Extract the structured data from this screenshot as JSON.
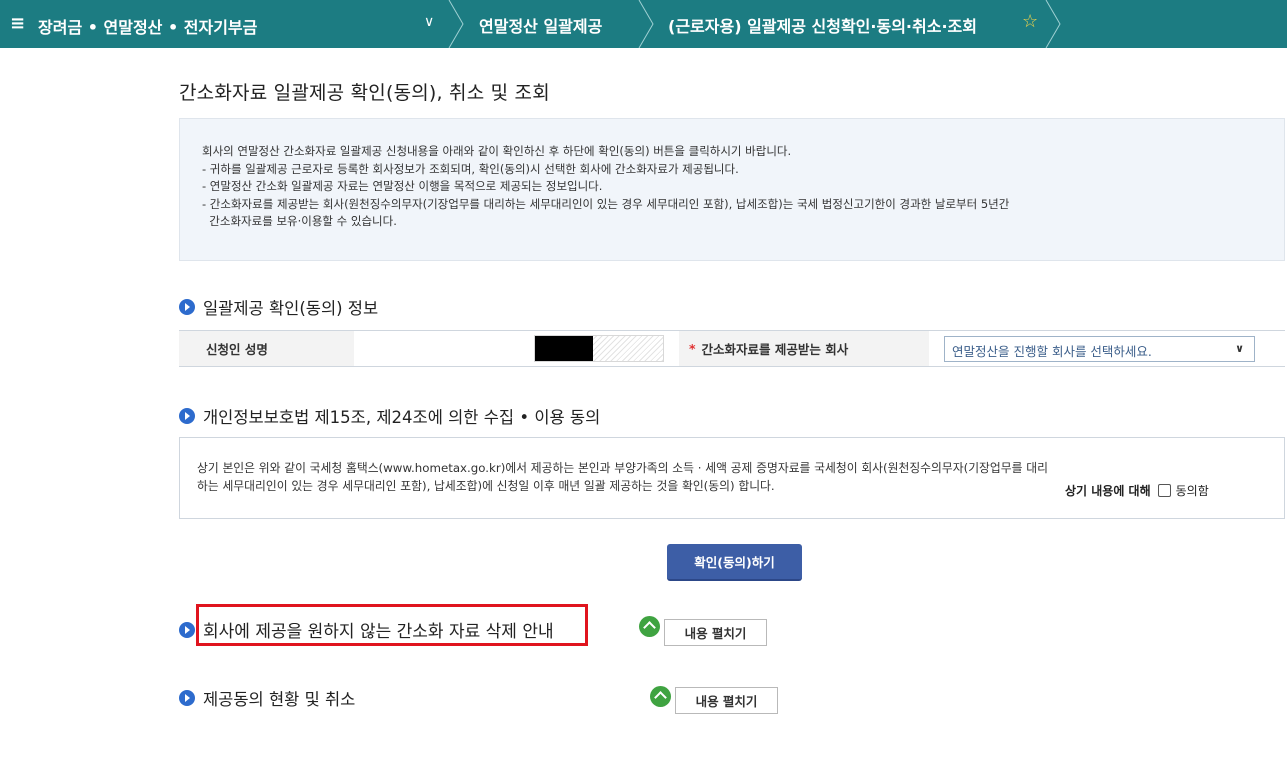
{
  "colors": {
    "nav_bg": "#1c7c82",
    "accent": "#3d5ea6",
    "highlight": "#e0141e",
    "expand_icon": "#3fa341",
    "section_icon": "#2d6bcd",
    "star": "#f2d44a"
  },
  "topbar": {
    "menu_icon": "≡",
    "category": "장려금 • 연말정산 • 전자기부금",
    "caret": "∨",
    "item1": "연말정산 일괄제공",
    "item2": "(근로자용) 일괄제공 신청확인·동의·취소·조회",
    "favorite_icon": "☆"
  },
  "page_title": "간소화자료 일괄제공 확인(동의), 취소 및 조회",
  "notice": {
    "lines": [
      "회사의 연말정산 간소화자료 일괄제공 신청내용을 아래와 같이 확인하신 후 하단에 확인(동의) 버튼을 클릭하시기 바랍니다.",
      "- 귀하를 일괄제공 근로자로 등록한 회사정보가 조회되며, 확인(동의)시 선택한 회사에 간소화자료가 제공됩니다.",
      "- 연말정산 간소화 일괄제공 자료는 연말정산 이행을 목적으로 제공되는 정보입니다.",
      "- 간소화자료를 제공받는 회사(원천징수의무자(기장업무를 대리하는 세무대리인이 있는 경우 세무대리인 포함), 납세조합)는 국세 법정신고기한이 경과한 날로부터 5년간",
      "  간소화자료를 보유·이용할 수 있습니다."
    ]
  },
  "section_confirm": {
    "title": "일괄제공 확인(동의) 정보",
    "applicant_label": "신청인 성명",
    "company_label_star": "*",
    "company_label": "간소화자료를 제공받는 회사",
    "company_select": {
      "placeholder": "연말정산을 진행할 회사를 선택하세요.",
      "caret": "∨"
    }
  },
  "section_privacy": {
    "title": "개인정보보호법 제15조, 제24조에 의한 수집 • 이용 동의",
    "text_line1": "상기 본인은 위와 같이 국세청 홈택스(www.hometax.go.kr)에서 제공하는 본인과 부양가족의 소득 · 세액 공제 증명자료를 국세청이 회사(원천징수의무자(기장업무를 대리",
    "text_line2": "하는 세무대리인이 있는 경우 세무대리인 포함), 납세조합)에 신청일 이후 매년 일괄 제공하는 것을 확인(동의) 합니다.",
    "agree_lead": "상기 내용에 대해",
    "agree_label": "동의함"
  },
  "confirm_button": "확인(동의)하기",
  "section_delete": {
    "title": "회사에 제공을 원하지 않는 간소화 자료 삭제 안내",
    "expand_label": "내용 펼치기"
  },
  "section_status": {
    "title": "제공동의 현황 및 취소",
    "expand_label": "내용 펼치기"
  }
}
